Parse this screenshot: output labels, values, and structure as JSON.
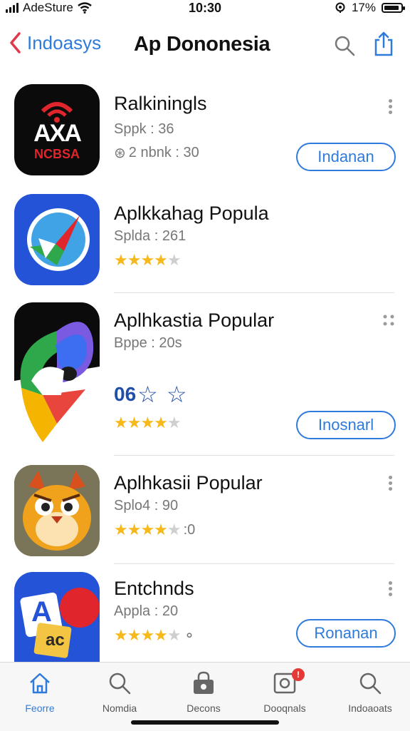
{
  "status": {
    "carrier": "AdeSture",
    "time": "10:30",
    "battery_text": "17%",
    "battery_level": 0.9
  },
  "nav": {
    "back_label": "Indoasys",
    "title": "Ap Dononesia"
  },
  "apps": [
    {
      "name": "Ralkiningls",
      "sub": "Sppk : 36",
      "extra": "2 nbnk : 30",
      "icon_text": "AXA",
      "icon_subtext": "NCBSA",
      "action_label": "Indanan"
    },
    {
      "name": "Aplkkahag Popula",
      "sub": "Splda : 261",
      "rating": 4
    },
    {
      "name": "Aplhkastia Popular",
      "sub": "Bppe : 20s",
      "badge_num": "06",
      "rating": 4,
      "action_label": "Inosnarl"
    },
    {
      "name": "Aplhkasii Popular",
      "sub": "Splo4 : 90",
      "rating": 4,
      "rating_tail": ":0"
    },
    {
      "name": "Entchnds",
      "sub": "Appla : 20",
      "rating": 4,
      "icon_text": "A",
      "icon_subtext": "ac",
      "action_label": "Ronanan"
    }
  ],
  "tabs": [
    {
      "label": "Feorre",
      "icon": "home-icon",
      "active": true
    },
    {
      "label": "Nomdia",
      "icon": "search-icon"
    },
    {
      "label": "Decons",
      "icon": "bag-icon"
    },
    {
      "label": "Dooqnals",
      "icon": "camera-icon"
    },
    {
      "label": "Indoaoats",
      "icon": "search-icon"
    }
  ],
  "colors": {
    "accent": "#2f7bdc",
    "star": "#f6b81a",
    "badge": "#e53935"
  }
}
